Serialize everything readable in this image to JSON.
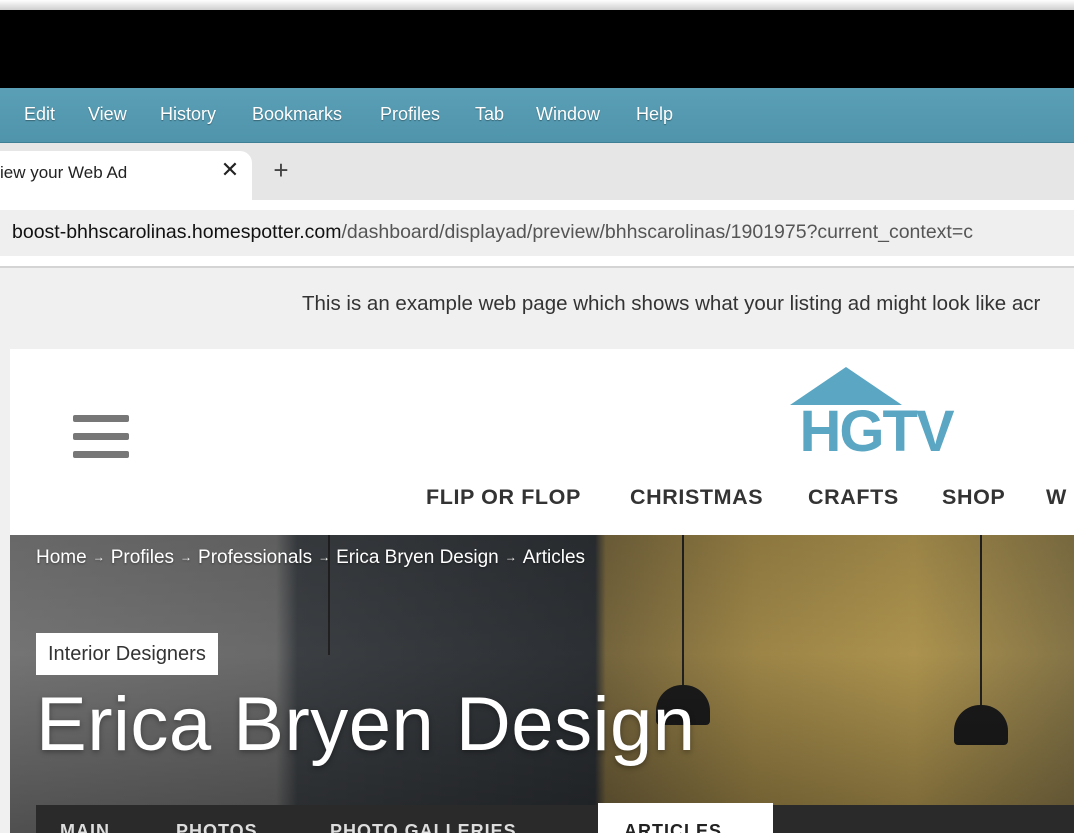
{
  "menubar": {
    "items": [
      "Edit",
      "View",
      "History",
      "Bookmarks",
      "Profiles",
      "Tab",
      "Window",
      "Help"
    ]
  },
  "tab": {
    "title": "iew your Web Ad",
    "close_glyph": "✕",
    "new_tab_glyph": "+"
  },
  "address": {
    "host": "boost-bhhscarolinas.homespotter.com",
    "path": "/dashboard/displayad/preview/bhhscarolinas/1901975?current_context=c"
  },
  "notice": "This is an example web page which shows what your listing ad might look like acr",
  "site": {
    "logo_text": "HGTV",
    "logo_color": "#5aa6c3",
    "nav": [
      "FLIP OR FLOP",
      "CHRISTMAS",
      "CRAFTS",
      "SHOP",
      "W"
    ],
    "breadcrumb": [
      "Home",
      "Profiles",
      "Professionals",
      "Erica Bryen Design",
      "Articles"
    ],
    "breadcrumb_sep": "→",
    "category_badge": "Interior Designers",
    "title": "Erica Bryen Design",
    "subnav": [
      "MAIN",
      "PHOTOS",
      "PHOTO GALLERIES",
      "ARTICLES"
    ]
  },
  "icons": {
    "menu": "hamburger-icon",
    "close": "close-icon",
    "add": "plus-icon"
  }
}
